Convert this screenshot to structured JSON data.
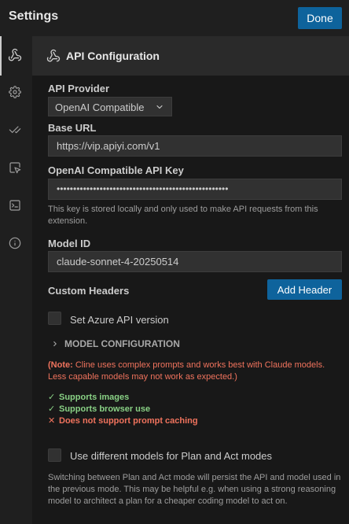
{
  "window": {
    "title": "Settings",
    "done_label": "Done"
  },
  "sidebar": {
    "items": [
      {
        "icon": "webhook-icon",
        "active": true
      },
      {
        "icon": "gear-icon"
      },
      {
        "icon": "check-check-icon"
      },
      {
        "icon": "square-pointer-icon"
      },
      {
        "icon": "terminal-icon"
      },
      {
        "icon": "info-icon"
      }
    ]
  },
  "section": {
    "title": "API Configuration",
    "icon": "webhook-icon"
  },
  "form": {
    "api_provider": {
      "label": "API Provider",
      "value": "OpenAI Compatible"
    },
    "base_url": {
      "label": "Base URL",
      "value": "https://vip.apiyi.com/v1"
    },
    "api_key": {
      "label": "OpenAI Compatible API Key",
      "value": "••••••••••••••••••••••••••••••••••••••••••••••••••••",
      "hint": "This key is stored locally and only used to make API requests from this extension."
    },
    "model_id": {
      "label": "Model ID",
      "value": "claude-sonnet-4-20250514"
    },
    "custom_headers": {
      "label": "Custom Headers",
      "add_label": "Add Header"
    },
    "azure_version": {
      "label": "Set Azure API version",
      "checked": false
    },
    "model_config": {
      "label": "MODEL CONFIGURATION"
    },
    "note": {
      "prefix": "(Note:",
      "text": " Cline uses complex prompts and works best with Claude models. Less capable models may not work as expected.)"
    },
    "capabilities": [
      {
        "mark": "✓",
        "text": "Supports images",
        "ok": true
      },
      {
        "mark": "✓",
        "text": "Supports browser use",
        "ok": true
      },
      {
        "mark": "✕",
        "text": "Does not support prompt caching",
        "ok": false
      }
    ],
    "plan_act": {
      "label": "Use different models for Plan and Act modes",
      "checked": false,
      "hint": "Switching between Plan and Act mode will persist the API and model used in the previous mode. This may be helpful e.g. when using a strong reasoning model to architect a plan for a cheaper coding model to act on."
    }
  },
  "colors": {
    "accent": "#0e639c",
    "ok": "#89d185",
    "warn": "#f0735d"
  }
}
